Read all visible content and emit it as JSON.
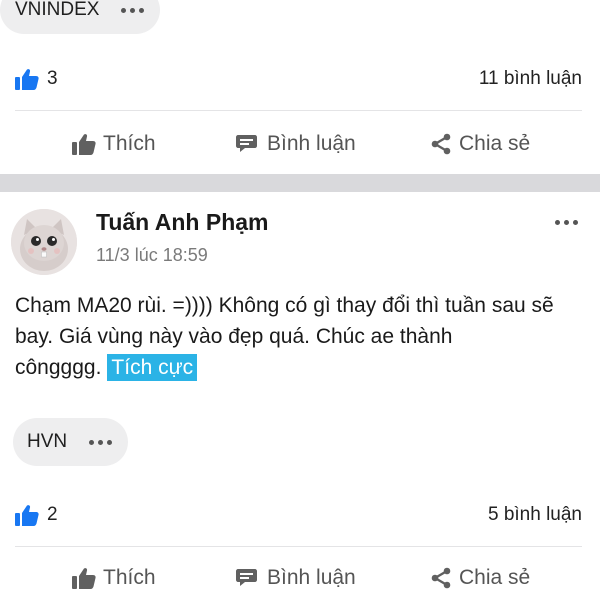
{
  "post1": {
    "ticker": "VNINDEX",
    "likes": "3",
    "comments": "11 bình luận"
  },
  "actions": {
    "like": "Thích",
    "comment": "Bình luận",
    "share": "Chia sẻ"
  },
  "post2": {
    "author": "Tuấn Anh Phạm",
    "timestamp": "11/3 lúc 18:59",
    "text": "Chạm MA20 rùi. =)))) Không có gì thay đổi thì tuần sau sẽ bay. Giá vùng này vào đẹp quá. Chúc ae thành côngggg.",
    "sentiment": "Tích cực",
    "ticker": "HVN",
    "likes": "2",
    "comments": "5 bình luận"
  },
  "colors": {
    "accent": "#1877f2",
    "sentiment_bg": "#2bb3e6",
    "chip_bg": "#eeeeef",
    "section_gap": "#d9d9dc"
  },
  "icons": [
    "thumbs-up-icon",
    "comment-icon",
    "share-icon",
    "more-dots-icon"
  ]
}
